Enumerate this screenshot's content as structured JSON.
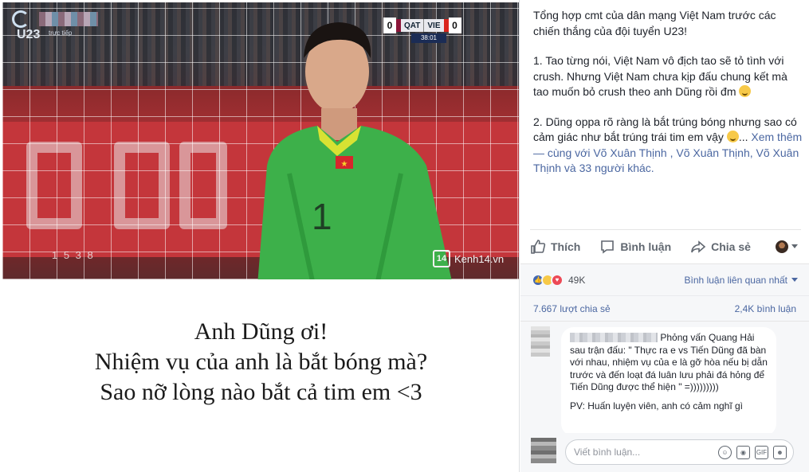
{
  "video": {
    "watermark_u23": "U23",
    "watermark_live": "trực tiếp",
    "scoreboard": {
      "home_score": "0",
      "home_team": "QAT",
      "away_team": "VIE",
      "away_score": "0",
      "time": "38:01"
    },
    "jersey_number": "1",
    "board_text": "1 5 3 8",
    "badge_number": "14",
    "badge_site": "Kenh14.vn"
  },
  "caption": {
    "line1": "Anh Dũng ơi!",
    "line2": "Nhiệm vụ của anh là bắt bóng mà?",
    "line3": "Sao nỡ lòng nào bắt cả tim em <3"
  },
  "post": {
    "intro": "Tổng hợp cmt của dân mạng Việt Nam trước các chiến thắng của đội tuyển U23!",
    "item1": "1. Tao từng nói, Việt Nam vô địch tao sẽ tỏ tình với crush. Nhưng Việt Nam chưa kịp đấu chung kết mà tao muốn bỏ crush theo anh Dũng rồi đm",
    "item2": "2. Dũng oppa rõ ràng là bắt trúng bóng nhưng sao có cảm giác như bắt trúng trái tim em vậy",
    "ellipsis": "...",
    "see_more": "Xem thêm",
    "with_prefix": " — cùng với ",
    "tag1": "Võ Xuân Thịnh",
    "sep1": " , ",
    "tag2": "Võ Xuân Thịnh",
    "sep2": ", ",
    "tag3": "Võ Xuân Thịnh",
    "and_text": " và ",
    "others": "33 người khác",
    "period": "."
  },
  "actions": {
    "like": "Thích",
    "comment": "Bình luận",
    "share": "Chia sẻ"
  },
  "stats": {
    "reaction_count": "49K",
    "related_comments": "Bình luận liên quan nhất",
    "shares": "7.667 lượt chia sẻ",
    "comments": "2,4K bình luận"
  },
  "comment": {
    "text": "Phỏng vấn Quang Hải sau trận đấu: \" Thực ra e vs Tiến Dũng đã bàn với nhau, nhiệm vụ của e là gỡ hòa nếu bị dẫn trước và đến loạt đá luân lưu phải đá hỏng để Tiến Dũng được thể hiện \" =)))))))))",
    "pv": "PV: Huấn luyện viên, anh có cảm nghĩ gì"
  },
  "compose": {
    "placeholder": "Viết bình luận...",
    "icons": [
      "emoji-icon",
      "camera-icon",
      "gif-icon",
      "sticker-icon"
    ]
  },
  "colors": {
    "link": "#4b67a1",
    "like": "#4267b2",
    "love": "#ed4956",
    "haha": "#f7c948"
  }
}
